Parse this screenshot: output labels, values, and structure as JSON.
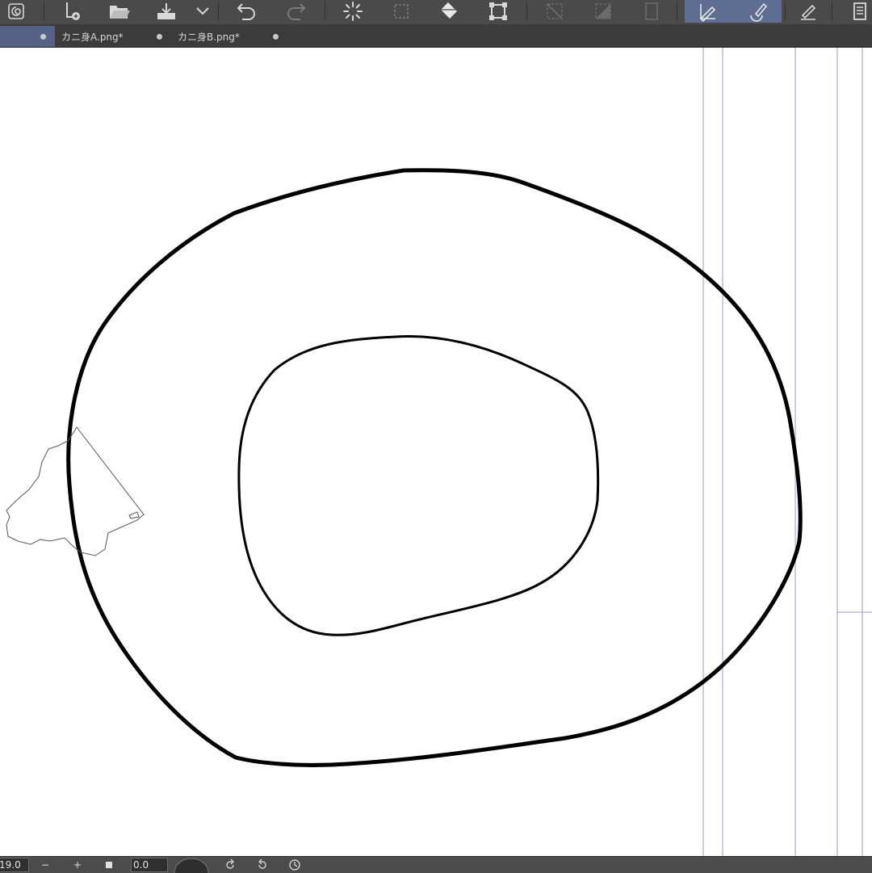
{
  "toolbar": {
    "buttons": [
      {
        "name": "app-logo-icon"
      },
      {
        "name": "new-file-icon"
      },
      {
        "name": "open-folder-icon"
      },
      {
        "name": "save-export-icon"
      },
      {
        "name": "chevron-down-icon"
      },
      {
        "name": "undo-icon"
      },
      {
        "name": "redo-icon"
      },
      {
        "name": "loading-spinner-icon"
      },
      {
        "name": "selection-fill-icon"
      },
      {
        "name": "fill-bucket-icon"
      },
      {
        "name": "transform-icon"
      },
      {
        "name": "hide-selection-icon"
      },
      {
        "name": "clear-outside-icon"
      },
      {
        "name": "canvas-frame-icon"
      },
      {
        "name": "pen-mode-icon",
        "active": true
      },
      {
        "name": "eraser-mode-icon",
        "active": true
      },
      {
        "name": "edit-pen-icon"
      },
      {
        "name": "panel-menu-icon"
      }
    ]
  },
  "tabs": [
    {
      "label": "",
      "active": true
    },
    {
      "label": "カニ身A.png*"
    },
    {
      "label": "カニ身B.png*"
    }
  ],
  "statusbar": {
    "zoom_value": "19.0",
    "zoom_out_label": "−",
    "zoom_in_label": "+",
    "angle_value": "0.0"
  },
  "colors": {
    "toolbar_bg": "#4a4a4a",
    "tab_active": "#546387",
    "active_button": "#5d6e92",
    "stroke": "#000000",
    "guide_line": "#9a9ad0"
  }
}
